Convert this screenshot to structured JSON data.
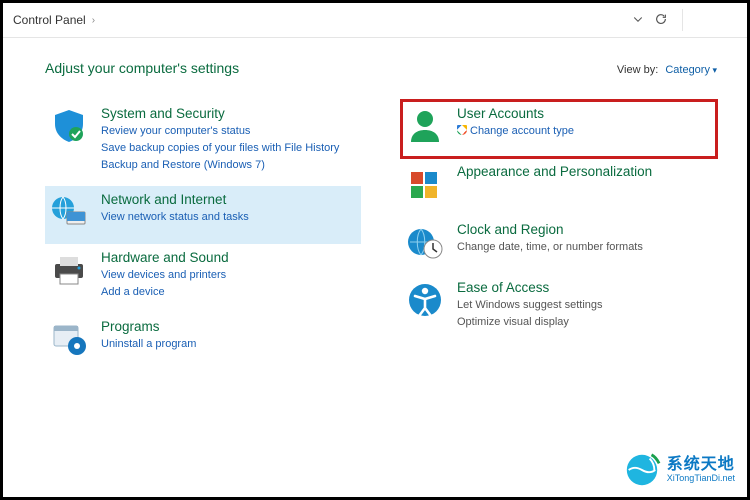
{
  "breadcrumb": {
    "root": "Control Panel"
  },
  "page": {
    "heading": "Adjust your computer's settings",
    "viewby_label": "View by:",
    "viewby_value": "Category"
  },
  "left_column": [
    {
      "id": "system-security",
      "title": "System and Security",
      "links": [
        {
          "text": "Review your computer's status"
        },
        {
          "text": "Save backup copies of your files with File History"
        },
        {
          "text": "Backup and Restore (Windows 7)"
        }
      ],
      "selected": false,
      "highlighted": false,
      "icon": "shield"
    },
    {
      "id": "network-internet",
      "title": "Network and Internet",
      "links": [
        {
          "text": "View network status and tasks"
        }
      ],
      "selected": true,
      "highlighted": false,
      "icon": "globe-monitor"
    },
    {
      "id": "hardware-sound",
      "title": "Hardware and Sound",
      "links": [
        {
          "text": "View devices and printers"
        },
        {
          "text": "Add a device"
        }
      ],
      "selected": false,
      "highlighted": false,
      "icon": "printer"
    },
    {
      "id": "programs",
      "title": "Programs",
      "links": [
        {
          "text": "Uninstall a program"
        }
      ],
      "selected": false,
      "highlighted": false,
      "icon": "app-disc"
    }
  ],
  "right_column": [
    {
      "id": "user-accounts",
      "title": "User Accounts",
      "links": [
        {
          "text": "Change account type",
          "shield": true
        }
      ],
      "selected": false,
      "highlighted": true,
      "icon": "user"
    },
    {
      "id": "appearance",
      "title": "Appearance and Personalization",
      "links": [],
      "selected": false,
      "highlighted": false,
      "icon": "personalize"
    },
    {
      "id": "clock-region",
      "title": "Clock and Region",
      "descs": [
        {
          "text": "Change date, time, or number formats"
        }
      ],
      "selected": false,
      "highlighted": false,
      "icon": "clock-globe"
    },
    {
      "id": "ease-of-access",
      "title": "Ease of Access",
      "descs": [
        {
          "text": "Let Windows suggest settings"
        },
        {
          "text": "Optimize visual display"
        }
      ],
      "selected": false,
      "highlighted": false,
      "icon": "ease"
    }
  ],
  "watermark": {
    "cn": "系统天地",
    "en": "XiTongTianDi.net"
  }
}
